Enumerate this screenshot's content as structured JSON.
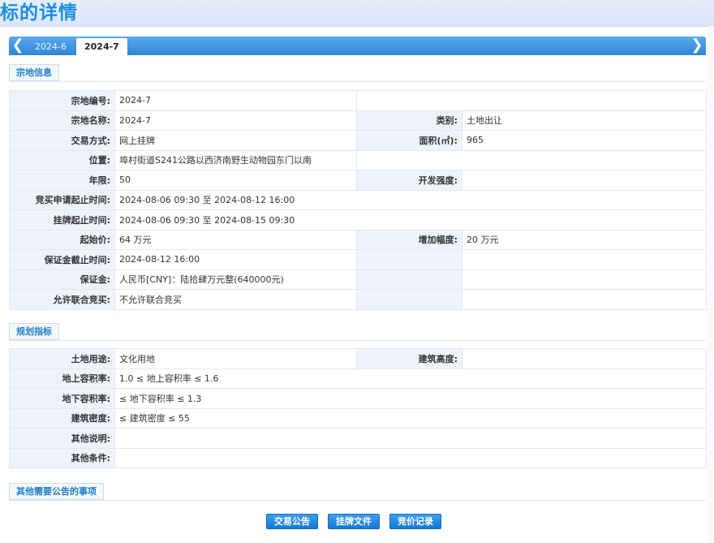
{
  "page": {
    "title": "标的详情"
  },
  "tabs": [
    {
      "label": "2024-6"
    },
    {
      "label": "2024-7"
    }
  ],
  "sections": {
    "land": "宗地信息",
    "planning": "规划指标",
    "other": "其他需要公告的事项"
  },
  "land": {
    "code_label": "宗地编号:",
    "code": "2024-7",
    "name_label": "宗地名称:",
    "name": "2024-7",
    "category_label": "类别:",
    "category": "土地出让",
    "method_label": "交易方式:",
    "method": "网上挂牌",
    "area_label": "面积(㎡):",
    "area": "965",
    "location_label": "位置:",
    "location": "埠村街道S241公路以西济南野生动物园东门以南",
    "term_label": "年限:",
    "term": "50",
    "intensity_label": "开发强度:",
    "intensity": "",
    "apply_label": "竞买申请起止时间:",
    "apply": "2024-08-06 09:30 至 2024-08-12 16:00",
    "listing_label": "挂牌起止时间:",
    "listing": "2024-08-06 09:30 至 2024-08-15 09:30",
    "start_price_label": "起始价:",
    "start_price": "64 万元",
    "increment_label": "增加幅度:",
    "increment": "20 万元",
    "deposit_deadline_label": "保证金截止时间:",
    "deposit_deadline": "2024-08-12 16:00",
    "deposit_label": "保证金:",
    "deposit": "人民币[CNY]：陆拾肆万元整(640000元)",
    "joint_label": "允许联合竞买:",
    "joint": "不允许联合竞买"
  },
  "planning": {
    "use_label": "土地用途:",
    "use": "文化用地",
    "height_label": "建筑高度:",
    "height": "",
    "far_above_label": "地上容积率:",
    "far_above": "1.0 ≤ 地上容积率 ≤ 1.6",
    "far_below_label": "地下容积率:",
    "far_below": "≤ 地下容积率 ≤ 1.3",
    "density_label": "建筑密度:",
    "density": "≤ 建筑密度 ≤ 55",
    "note_label": "其他说明:",
    "note": "",
    "conditions_label": "其他条件:",
    "conditions": ""
  },
  "buttons": {
    "announcement": "交易公告",
    "files": "挂牌文件",
    "bids": "竞价记录"
  }
}
